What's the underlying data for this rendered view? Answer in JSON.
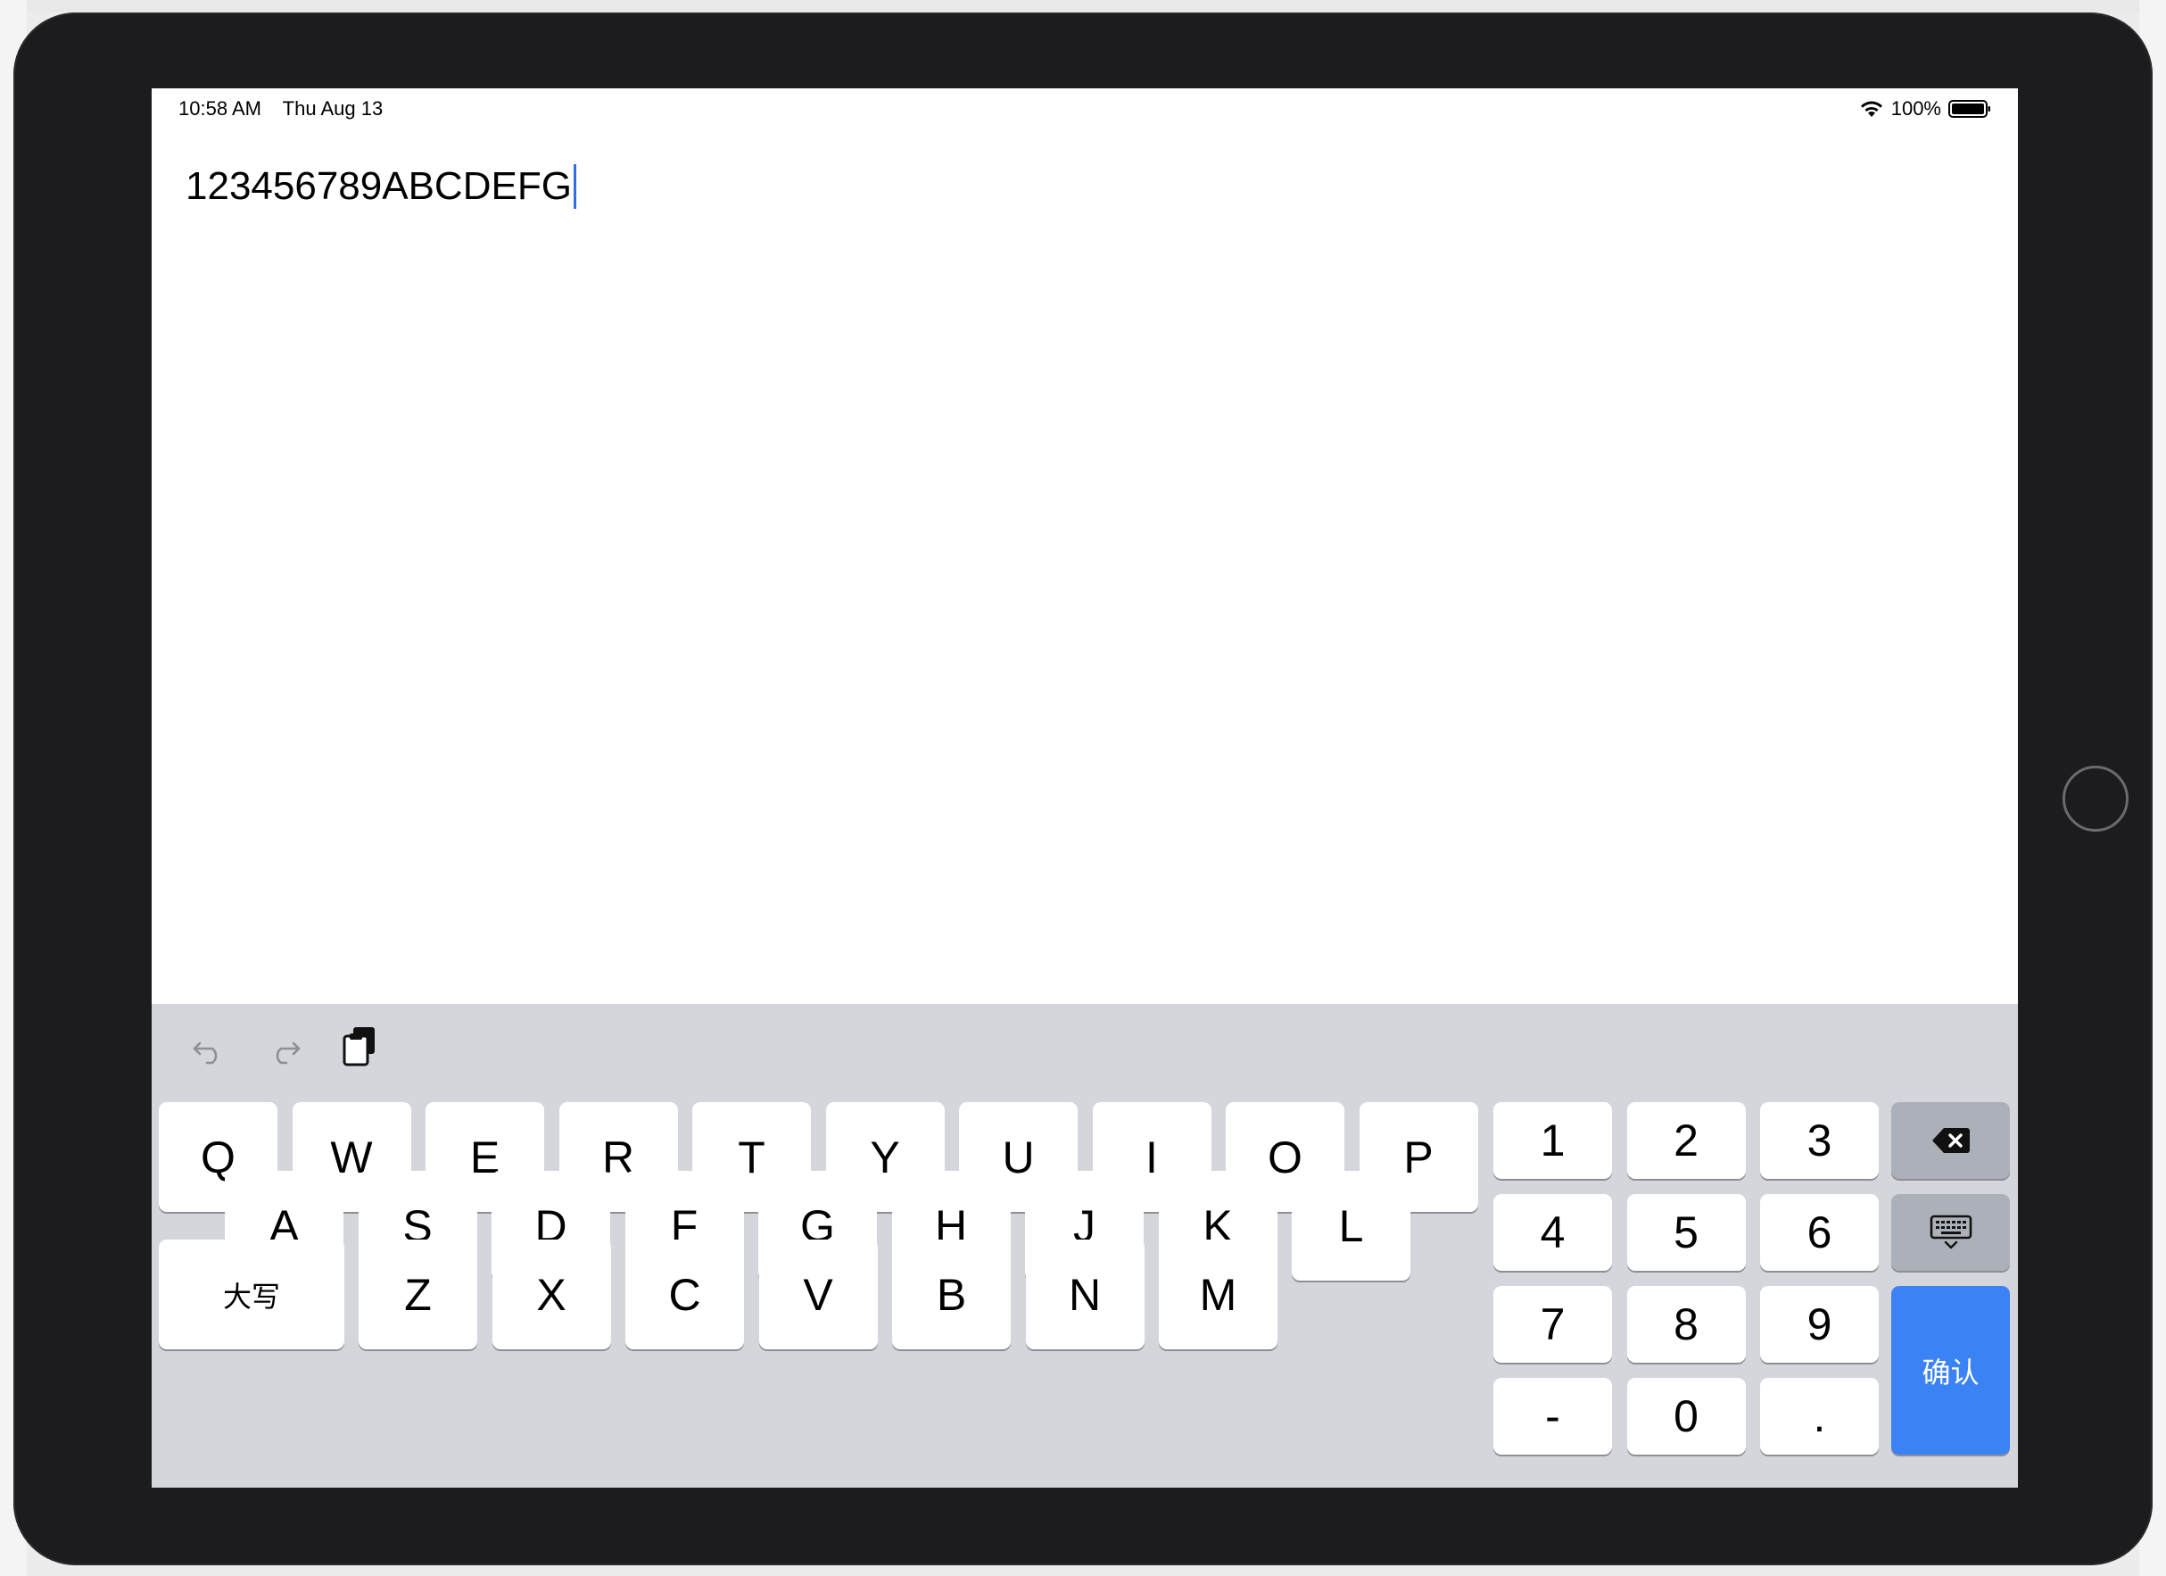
{
  "status_bar": {
    "time": "10:58 AM",
    "date": "Thu Aug 13",
    "battery_percent": "100%",
    "wifi_icon": "wifi-icon",
    "battery_icon": "battery-full-icon"
  },
  "editor": {
    "text": "123456789ABCDEFG"
  },
  "toolbar": {
    "undo_icon": "undo-icon",
    "redo_icon": "redo-icon",
    "paste_icon": "clipboard-paste-icon"
  },
  "keyboard": {
    "row1": [
      "Q",
      "W",
      "E",
      "R",
      "T",
      "Y",
      "U",
      "I",
      "O",
      "P"
    ],
    "row2": [
      "A",
      "S",
      "D",
      "F",
      "G",
      "H",
      "J",
      "K",
      "L"
    ],
    "row3": [
      "Z",
      "X",
      "C",
      "V",
      "B",
      "N",
      "M"
    ],
    "caps_label": "大写",
    "numpad": [
      [
        "1",
        "2",
        "3"
      ],
      [
        "4",
        "5",
        "6"
      ],
      [
        "7",
        "8",
        "9"
      ],
      [
        "-",
        "0",
        "."
      ]
    ],
    "confirm_label": "确认",
    "backspace_icon": "backspace-icon",
    "dismiss_icon": "keyboard-dismiss-icon",
    "confirm_color": "#3b82f5",
    "key_background": "#d4d6dc"
  }
}
